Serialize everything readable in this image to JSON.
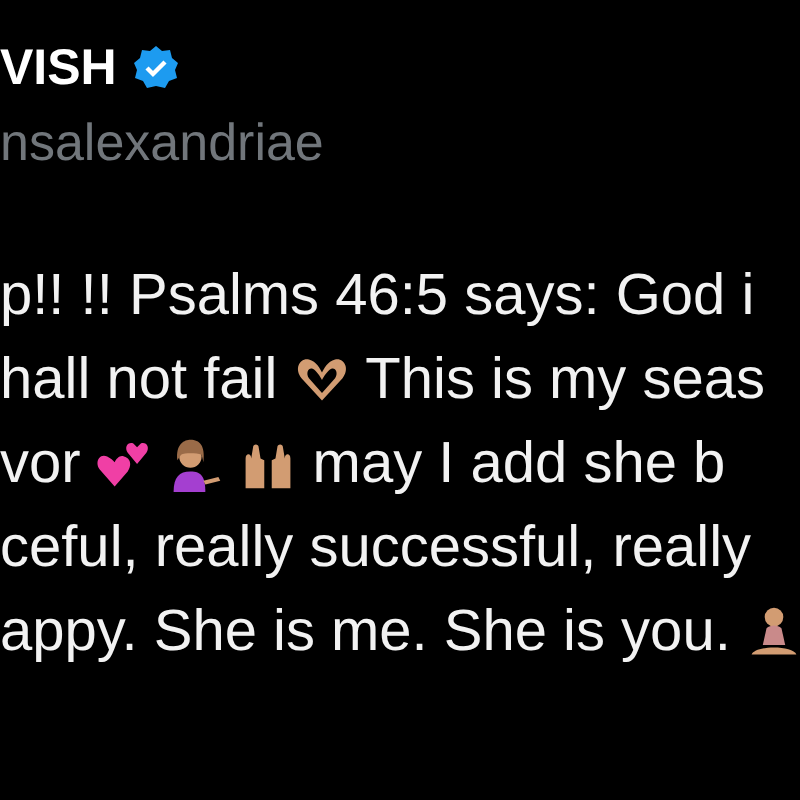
{
  "author": {
    "name": "VISH",
    "verified": true,
    "handle": "nsalexandriae"
  },
  "lines": [
    {
      "parts": [
        {
          "kind": "text",
          "text": "p!! !! Psalms 46:5 says: God i"
        }
      ]
    },
    {
      "parts": [
        {
          "kind": "text",
          "text": "hall not fail"
        },
        {
          "kind": "heart-hands"
        },
        {
          "kind": "text",
          "text": "This is my seas"
        }
      ]
    },
    {
      "parts": [
        {
          "kind": "text",
          "text": "vor"
        },
        {
          "kind": "hearts"
        },
        {
          "kind": "person"
        },
        {
          "kind": "raised-hands"
        },
        {
          "kind": "text",
          "text": "may I add she b"
        }
      ]
    },
    {
      "parts": [
        {
          "kind": "text",
          "text": "ceful, really successful, really"
        }
      ]
    },
    {
      "parts": [
        {
          "kind": "text",
          "text": "appy. She is me. She is you."
        },
        {
          "kind": "meditating"
        }
      ]
    }
  ]
}
